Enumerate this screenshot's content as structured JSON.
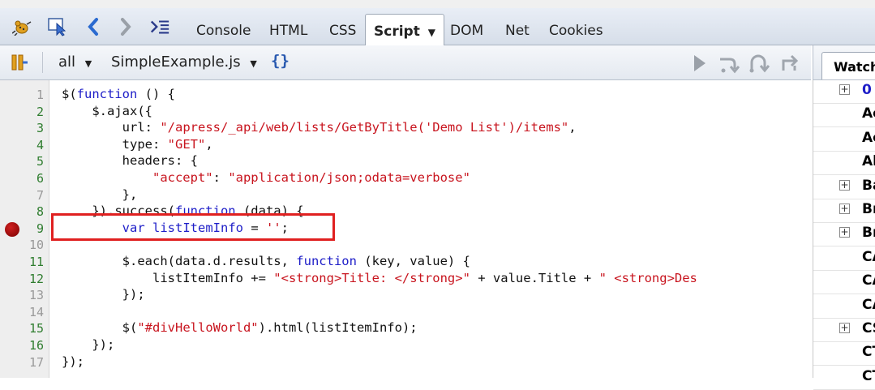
{
  "tabs": [
    "Console",
    "HTML",
    "CSS",
    "Script",
    "DOM",
    "Net",
    "Cookies"
  ],
  "toolbar": {
    "scope": "all",
    "file": "SimpleExample.js",
    "format_glyph": "{}"
  },
  "watch": {
    "tab_label": "Watch",
    "rows": [
      {
        "name": "0",
        "expandable": true
      },
      {
        "name": "Ac",
        "expandable": false
      },
      {
        "name": "Ac",
        "expandable": false
      },
      {
        "name": "Al",
        "expandable": false
      },
      {
        "name": "Ba",
        "expandable": true
      },
      {
        "name": "Br",
        "expandable": true
      },
      {
        "name": "Br",
        "expandable": true
      },
      {
        "name": "CA",
        "expandable": false
      },
      {
        "name": "CA",
        "expandable": false
      },
      {
        "name": "CA",
        "expandable": false
      },
      {
        "name": "CS",
        "expandable": true
      },
      {
        "name": "CT",
        "expandable": false
      },
      {
        "name": "CT",
        "expandable": false
      }
    ]
  },
  "code": {
    "breakpoint_line": 9,
    "lines": [
      {
        "n": "1",
        "exec": false
      },
      {
        "n": "2",
        "exec": true
      },
      {
        "n": "3",
        "exec": true
      },
      {
        "n": "4",
        "exec": true
      },
      {
        "n": "5",
        "exec": true
      },
      {
        "n": "6",
        "exec": true
      },
      {
        "n": "7",
        "exec": false
      },
      {
        "n": "8",
        "exec": true
      },
      {
        "n": "9",
        "exec": true
      },
      {
        "n": "10",
        "exec": false
      },
      {
        "n": "11",
        "exec": true
      },
      {
        "n": "12",
        "exec": true
      },
      {
        "n": "13",
        "exec": false
      },
      {
        "n": "14",
        "exec": false
      },
      {
        "n": "15",
        "exec": true
      },
      {
        "n": "16",
        "exec": true
      },
      {
        "n": "17",
        "exec": false
      }
    ],
    "tokens": [
      [
        [
          "p",
          "$("
        ],
        [
          "k",
          "function"
        ],
        [
          "p",
          " () {"
        ]
      ],
      [
        [
          "p",
          "    $.ajax({"
        ]
      ],
      [
        [
          "p",
          "        url: "
        ],
        [
          "s",
          "\"/apress/_api/web/lists/GetByTitle('Demo List')/items\""
        ],
        [
          "p",
          ","
        ]
      ],
      [
        [
          "p",
          "        type: "
        ],
        [
          "s",
          "\"GET\""
        ],
        [
          "p",
          ","
        ]
      ],
      [
        [
          "p",
          "        headers: {"
        ]
      ],
      [
        [
          "p",
          "            "
        ],
        [
          "s",
          "\"accept\""
        ],
        [
          "p",
          ": "
        ],
        [
          "s",
          "\"application/json;odata=verbose\""
        ]
      ],
      [
        [
          "p",
          "        },"
        ]
      ],
      [
        [
          "p",
          "    }).success("
        ],
        [
          "k",
          "function"
        ],
        [
          "p",
          " (data) {"
        ]
      ],
      [
        [
          "p",
          "        "
        ],
        [
          "k",
          "var"
        ],
        [
          "p",
          " "
        ],
        [
          "i",
          "listItemInfo"
        ],
        [
          "p",
          " = "
        ],
        [
          "s",
          "''"
        ],
        [
          "p",
          ";"
        ]
      ],
      [
        [
          "p",
          ""
        ]
      ],
      [
        [
          "p",
          "        $.each(data.d.results, "
        ],
        [
          "k",
          "function"
        ],
        [
          "p",
          " (key, value) {"
        ]
      ],
      [
        [
          "p",
          "            listItemInfo += "
        ],
        [
          "s",
          "\"<strong>Title: </strong>\""
        ],
        [
          "p",
          " + value.Title + "
        ],
        [
          "s",
          "\" <strong>Des"
        ]
      ],
      [
        [
          "p",
          "        });"
        ]
      ],
      [
        [
          "p",
          ""
        ]
      ],
      [
        [
          "p",
          "        $("
        ],
        [
          "s",
          "\"#divHelloWorld\""
        ],
        [
          "p",
          ").html(listItemInfo);"
        ]
      ],
      [
        [
          "p",
          "    });"
        ]
      ],
      [
        [
          "p",
          "});"
        ]
      ]
    ]
  }
}
